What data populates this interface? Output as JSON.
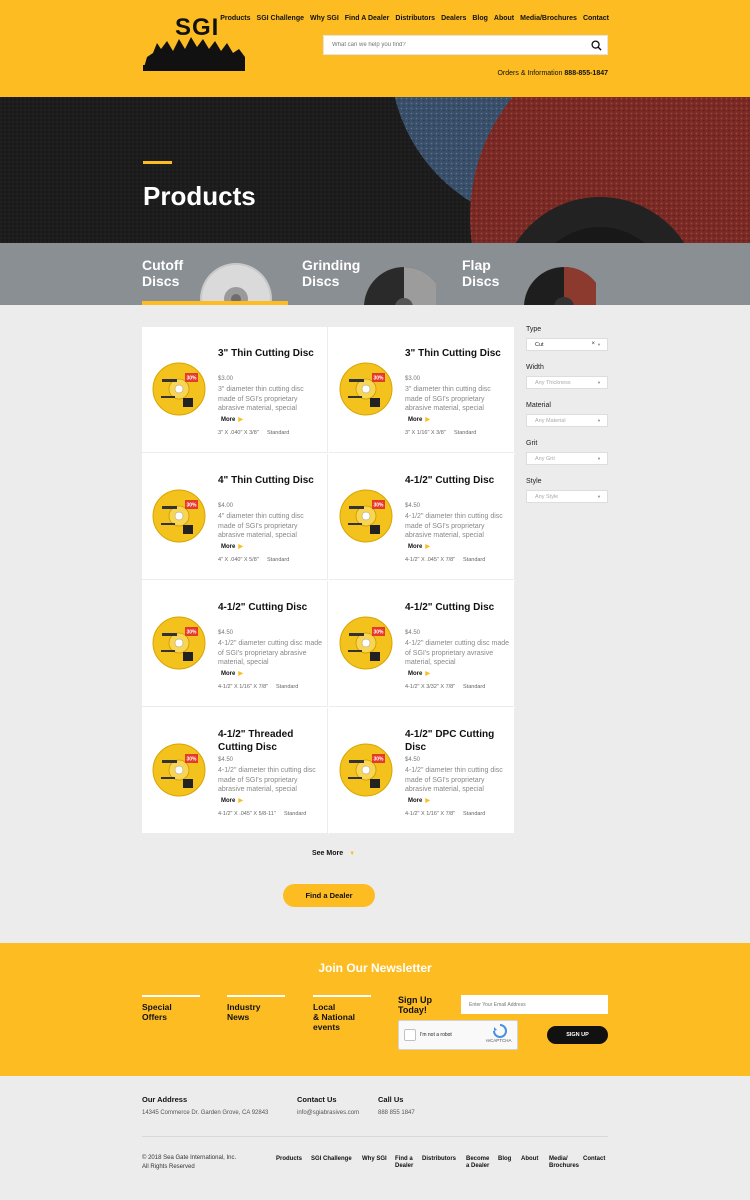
{
  "header": {
    "logo_text": "SGI",
    "nav": [
      "Products",
      "SGI Challenge",
      "Why SGI",
      "Find A Dealer",
      "Distributors",
      "Dealers",
      "Blog",
      "About",
      "Media/Brochures",
      "Contact"
    ],
    "search_placeholder": "What can we help you find?",
    "orders_label": "Orders & Information",
    "orders_phone": "888-855-1847"
  },
  "hero": {
    "title": "Products"
  },
  "categories": [
    {
      "line1": "Cutoff",
      "line2": "Discs",
      "active": true
    },
    {
      "line1": "Grinding",
      "line2": "Discs",
      "active": false
    },
    {
      "line1": "Flap",
      "line2": "Discs",
      "active": false
    }
  ],
  "products": [
    {
      "title": "3\" Thin Cutting Disc",
      "price": "$3.00",
      "desc": "3\" diameter thin cutting disc made of SGI's proprietary abrasive material, special",
      "more": "More",
      "dim": "3\" X .040\" X 3/8\"",
      "grade": "Standard",
      "badge": "30%"
    },
    {
      "title": "3\" Thin Cutting Disc",
      "price": "$3.00",
      "desc": "3\" diameter thin cutting disc made of SGI's proprietary abrasive material, special",
      "more": "More",
      "dim": "3\" X 1/16\" X 3/8\"",
      "grade": "Standard",
      "badge": "30%"
    },
    {
      "title": "4\" Thin Cutting Disc",
      "price": "$4.00",
      "desc": "4\" diameter thin cutting disc made of SGI's proprietary abrasive material, special",
      "more": "More",
      "dim": "4\" X .040\" X 5/8\"",
      "grade": "Standard",
      "badge": "30%"
    },
    {
      "title": "4-1/2\" Cutting Disc",
      "price": "$4.50",
      "desc": "4-1/2\" diameter thin cutting disc made of SGI's proprietary abrasive material, special",
      "more": "More",
      "dim": "4-1/2\" X .045\" X 7/8\"",
      "grade": "Standard",
      "badge": "30%"
    },
    {
      "title": "4-1/2\" Cutting Disc",
      "price": "$4.50",
      "desc": "4-1/2\" diameter cutting disc made of SGI's proprietary abrasive material, special",
      "more": "More",
      "dim": "4-1/2\" X 1/16\" X 7/8\"",
      "grade": "Standard",
      "badge": "30%"
    },
    {
      "title": "4-1/2\" Cutting Disc",
      "price": "$4.50",
      "desc": "4-1/2\" diameter cutting disc made of SGI's proprietary avrasive material, special",
      "more": "More",
      "dim": "4-1/2\" X 3/32\" X 7/8\"",
      "grade": "Standard",
      "badge": "30%"
    },
    {
      "title": "4-1/2\" Threaded Cutting Disc",
      "price": "$4.50",
      "desc": "4-1/2\" diameter thin cutting disc made of SGI's proprietary abrasive material, special",
      "more": "More",
      "dim": "4-1/2\" X .045\" X 5/8-11\"",
      "grade": "Standard",
      "badge": "30%"
    },
    {
      "title": "4-1/2\" DPC Cutting Disc",
      "price": "$4.50",
      "desc": "4-1/2\" diameter thin cutting disc made of SGI's proprietary abrasive material, special",
      "more": "More",
      "dim": "4-1/2\" X 1/16\" X 7/8\"",
      "grade": "Standard",
      "badge": "30%"
    }
  ],
  "filters": [
    {
      "label": "Type",
      "value": "Cut",
      "active": true
    },
    {
      "label": "Width",
      "value": "Any Thickness",
      "active": false
    },
    {
      "label": "Material",
      "value": "Any Material",
      "active": false
    },
    {
      "label": "Grit",
      "value": "Any Grit",
      "active": false
    },
    {
      "label": "Style",
      "value": "Any Style",
      "active": false
    }
  ],
  "see_more": "See More",
  "find_dealer": "Find a Dealer",
  "newsletter": {
    "title": "Join Our Newsletter",
    "cols": [
      [
        "Special",
        "Offers"
      ],
      [
        "Industry",
        "News"
      ],
      [
        "Local",
        "& National",
        "events"
      ]
    ],
    "signup_line1": "Sign Up",
    "signup_line2": "Today!",
    "email_placeholder": "Enter Your Email Address",
    "captcha_label": "I'm not a robot",
    "captcha_brand": "reCAPTCHA",
    "signup_button": "SIGN UP"
  },
  "footer": {
    "address_h": "Our Address",
    "address": "14345 Commerce Dr. Garden Grove, CA 92843",
    "contact_h": "Contact Us",
    "email": "info@sgiabrasives.com",
    "call_h": "Call Us",
    "phone": "888 855 1847",
    "copy1": "© 2018 Sea Gate International, Inc.",
    "copy2": "All Rights Reserved",
    "nav": [
      [
        "Products"
      ],
      [
        "SGI Challenge"
      ],
      [
        "Why SGI"
      ],
      [
        "Find a",
        "Dealer"
      ],
      [
        "Distributors"
      ],
      [
        "Become",
        "a Dealer"
      ],
      [
        "Blog"
      ],
      [
        "About"
      ],
      [
        "Media/",
        "Brochures"
      ],
      [
        "Contact"
      ]
    ]
  },
  "colors": {
    "brand_yellow": "#fdbd22",
    "dark": "#111111",
    "grey_strip": "#8a8f94"
  }
}
